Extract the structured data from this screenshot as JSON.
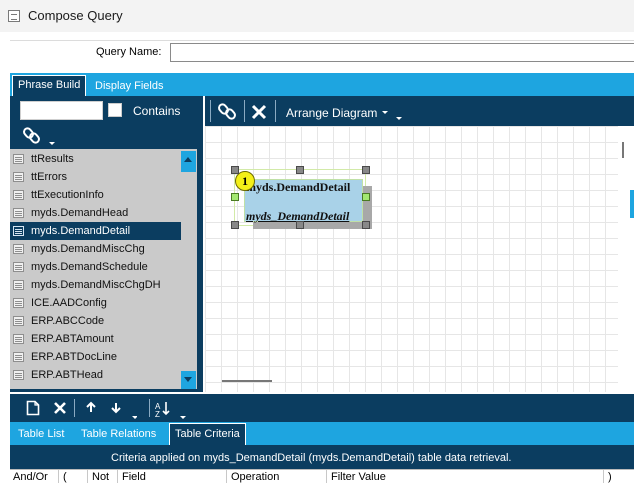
{
  "window": {
    "title": "Compose Query"
  },
  "query_name": {
    "label": "Query Name:",
    "value": ""
  },
  "top_tabs": [
    {
      "label": "Phrase Build",
      "active": true
    },
    {
      "label": "Display Fields",
      "active": false
    }
  ],
  "table_search": {
    "value": "",
    "contains_label": "Contains",
    "contains_checked": false
  },
  "table_list": {
    "items": [
      "ttResults",
      "ttErrors",
      "ttExecutionInfo",
      "myds.DemandHead",
      "myds.DemandDetail",
      "myds.DemandMiscChg",
      "myds.DemandSchedule",
      "myds.DemandMiscChgDH",
      "ICE.AADConfig",
      "ERP.ABCCode",
      "ERP.ABTAmount",
      "ERP.ABTDocLine",
      "ERP.ABTHead"
    ],
    "selected": "myds.DemandDetail"
  },
  "diagram_toolbar": {
    "arrange_label": "Arrange Diagram"
  },
  "diagram": {
    "node": {
      "badge": "1",
      "title": "myds.DemandDetail",
      "alias": "myds_DemandDetail"
    }
  },
  "bottom_tabs": [
    {
      "label": "Table List",
      "active": false
    },
    {
      "label": "Table Relations",
      "active": false
    },
    {
      "label": "Table Criteria",
      "active": true
    }
  ],
  "criteria": {
    "info": "Criteria applied on myds_DemandDetail (myds.DemandDetail)  table data retrieval.",
    "columns": [
      "And/Or",
      "(",
      "Not",
      "Field",
      "Operation",
      "Filter Value",
      ")"
    ]
  },
  "colors": {
    "navy": "#0b3d60",
    "accent_blue": "#1ea5e0",
    "node_fill": "#a9d2e8",
    "badge": "#f4f018"
  },
  "icons": [
    "app-icon",
    "link-icon",
    "close-icon",
    "new-document-icon",
    "arrow-up-icon",
    "arrow-down-icon",
    "sort-az-icon"
  ]
}
